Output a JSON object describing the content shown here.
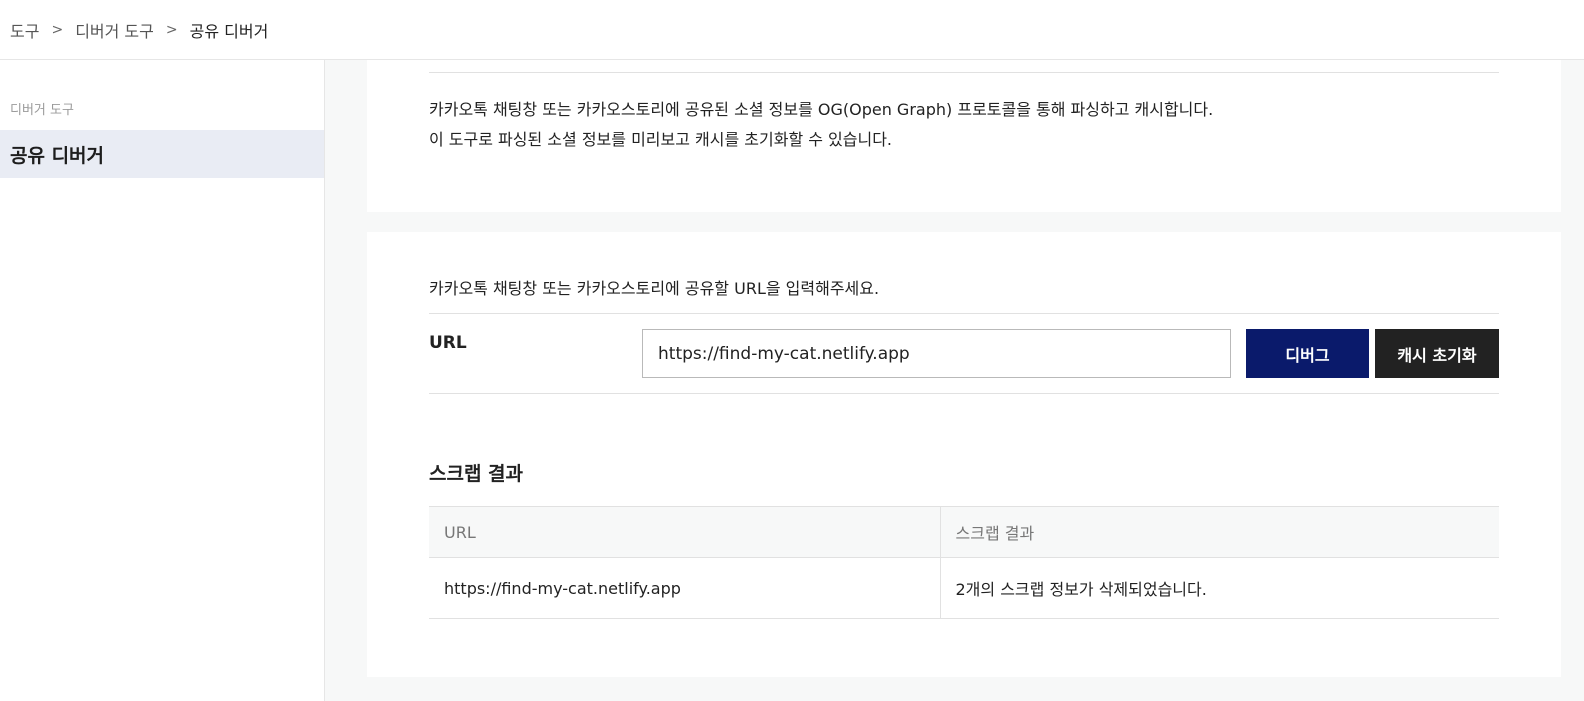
{
  "breadcrumb": {
    "items": [
      "도구",
      "디버거 도구",
      "공유 디버거"
    ],
    "separator": ">"
  },
  "sidebar": {
    "section_title": "디버거 도구",
    "items": [
      {
        "label": "공유 디버거",
        "active": true
      }
    ]
  },
  "intro": {
    "line1": "카카오톡 채팅창 또는 카카오스토리에 공유된 소셜 정보를 OG(Open Graph) 프로토콜을 통해 파싱하고 캐시합니다.",
    "line2": "이 도구로 파싱된 소셜 정보를 미리보고 캐시를 초기화할 수 있습니다."
  },
  "form": {
    "instruction": "카카오톡 채팅창 또는 카카오스토리에 공유할 URL을 입력해주세요.",
    "url_label": "URL",
    "url_value": "https://find-my-cat.netlify.app",
    "debug_button": "디버그",
    "reset_button": "캐시 초기화"
  },
  "results": {
    "title": "스크랩 결과",
    "columns": [
      "URL",
      "스크랩 결과"
    ],
    "rows": [
      {
        "url": "https://find-my-cat.netlify.app",
        "result": "2개의 스크랩 정보가 삭제되었습니다."
      }
    ]
  },
  "colors": {
    "primary_button": "#0a1a6b",
    "secondary_button": "#222222",
    "sidebar_active_bg": "#e9ecf4",
    "main_bg": "#f7f8f8"
  }
}
